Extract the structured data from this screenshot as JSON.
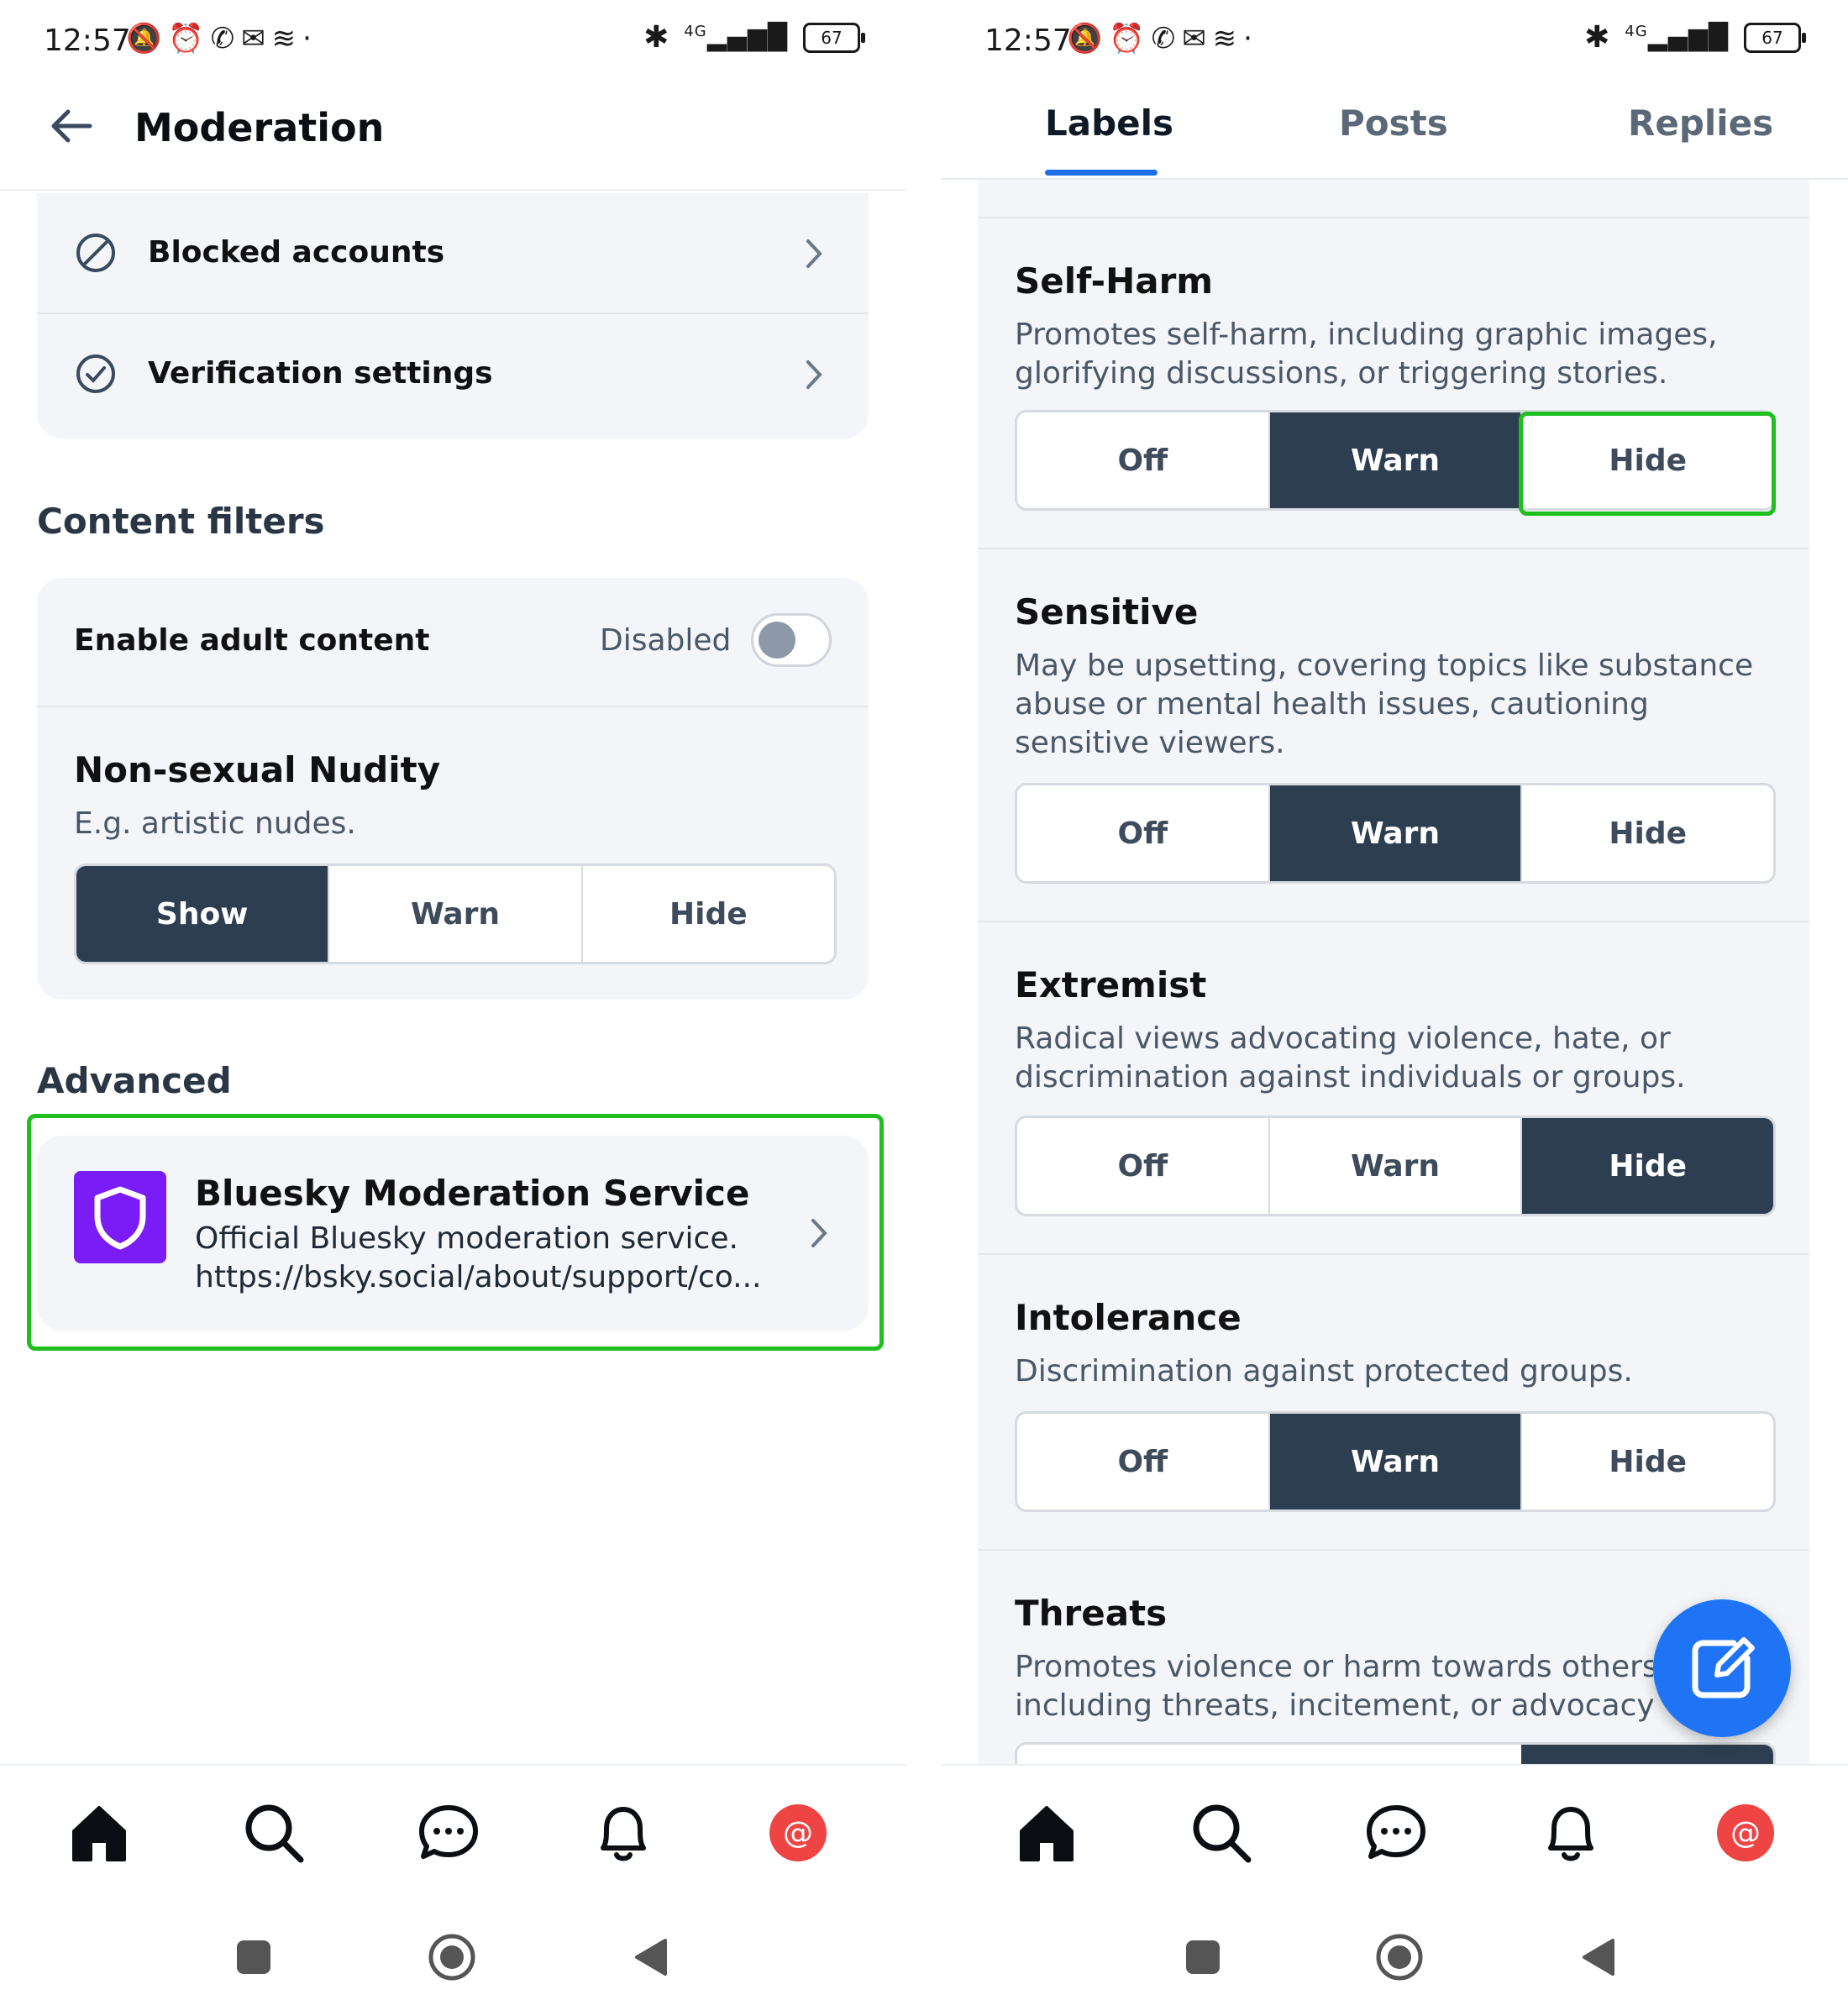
{
  "status_bar": {
    "time": "12:57",
    "battery": "67",
    "network": "4G"
  },
  "left": {
    "header": {
      "title": "Moderation"
    },
    "menu": [
      {
        "label": "Blocked accounts"
      },
      {
        "label": "Verification settings"
      }
    ],
    "content_filters": {
      "title": "Content filters",
      "adult": {
        "label": "Enable adult content",
        "state": "Disabled"
      },
      "nudity": {
        "title": "Non-sexual Nudity",
        "desc": "E.g. artistic nudes.",
        "options": [
          "Show",
          "Warn",
          "Hide"
        ],
        "selected": "Show"
      }
    },
    "advanced": {
      "title": "Advanced",
      "service": {
        "name": "Bluesky Moderation Service",
        "desc": "Official Bluesky moderation service.",
        "url": "https://bsky.social/about/support/co..."
      }
    }
  },
  "right": {
    "tabs": [
      "Labels",
      "Posts",
      "Replies"
    ],
    "active_tab": "Labels",
    "labels": [
      {
        "title": "Self-Harm",
        "desc": [
          "Promotes self-harm, including graphic images,",
          "glorifying discussions, or triggering stories."
        ],
        "options": [
          "Off",
          "Warn",
          "Hide"
        ],
        "selected": "Warn"
      },
      {
        "title": "Sensitive",
        "desc": [
          "May be upsetting, covering topics like substance",
          "abuse or mental health issues, cautioning",
          "sensitive viewers."
        ],
        "options": [
          "Off",
          "Warn",
          "Hide"
        ],
        "selected": "Warn"
      },
      {
        "title": "Extremist",
        "desc": [
          "Radical views advocating violence, hate, or",
          "discrimination against individuals or groups."
        ],
        "options": [
          "Off",
          "Warn",
          "Hide"
        ],
        "selected": "Hide"
      },
      {
        "title": "Intolerance",
        "desc": [
          "Discrimination against protected groups."
        ],
        "options": [
          "Off",
          "Warn",
          "Hide"
        ],
        "selected": "Warn"
      },
      {
        "title": "Threats",
        "desc": [
          "Promotes violence or harm towards others,",
          "including threats, incitement, or advocacy o"
        ]
      }
    ]
  },
  "colors": {
    "selected": "#2c3e50",
    "accent": "#1d6fe8",
    "highlight": "#1fbf1f",
    "service_icon": "#7a1cf5"
  },
  "icons": [
    "back-arrow-icon",
    "blocked-icon",
    "check-circle-icon",
    "chevron-right-icon",
    "shield-icon",
    "home-icon",
    "search-icon",
    "chat-icon",
    "bell-icon",
    "at-avatar-icon",
    "compose-icon"
  ]
}
